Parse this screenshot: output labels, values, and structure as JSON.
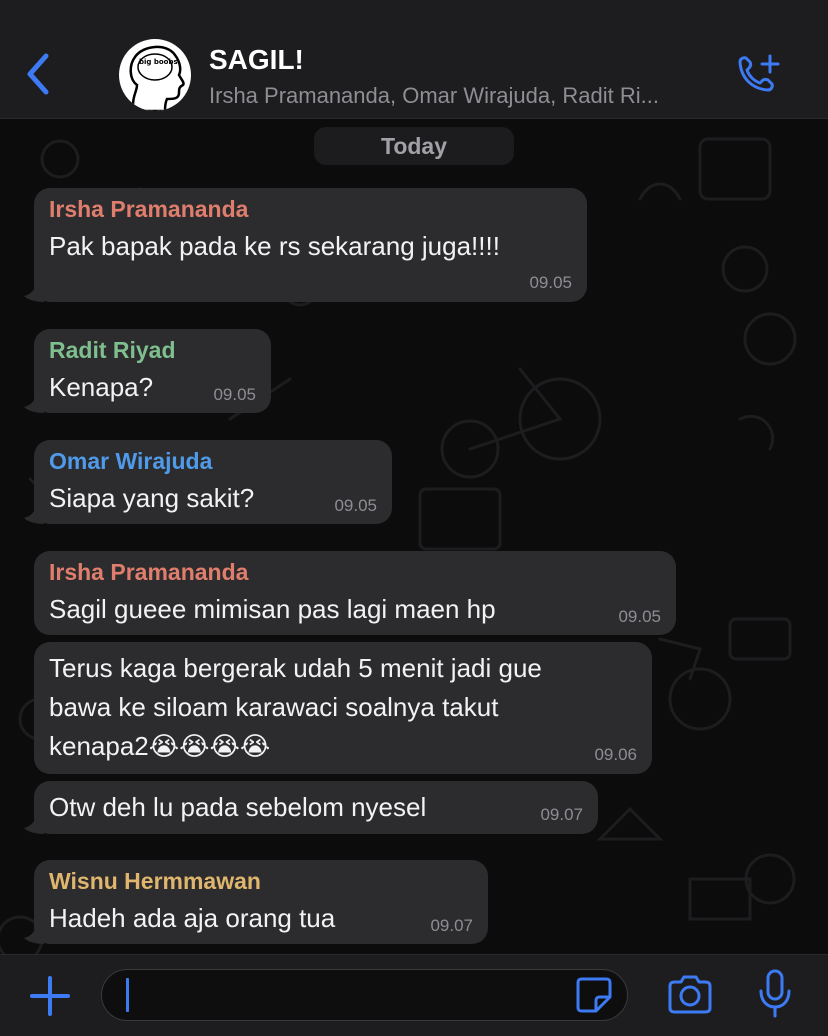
{
  "header": {
    "title": "SAGIL!",
    "subtitle": "Irsha Pramananda, Omar Wirajuda, Radit Ri...",
    "avatar_text": "big boobs"
  },
  "date_divider": "Today",
  "messages": [
    {
      "sender": "Irsha Pramananda",
      "sender_color": "#e07e6d",
      "lines": [
        "Pak bapak pada ke rs sekarang juga!!!!"
      ],
      "time": "09.05"
    },
    {
      "sender": "Radit Riyad",
      "sender_color": "#7fbf8e",
      "lines": [
        "Kenapa?"
      ],
      "time": "09.05"
    },
    {
      "sender": "Omar Wirajuda",
      "sender_color": "#4f9bea",
      "lines": [
        "Siapa yang sakit?"
      ],
      "time": "09.05"
    },
    {
      "sender": "Irsha Pramananda",
      "sender_color": "#e07e6d",
      "lines": [
        "Sagil gueee mimisan pas lagi maen hp"
      ],
      "time": "09.05"
    },
    {
      "sender": "",
      "lines": [
        "Terus kaga bergerak udah 5 menit jadi gue",
        "bawa ke siloam karawaci soalnya takut",
        "kenapa2😭😭😭😭"
      ],
      "time": "09.06"
    },
    {
      "sender": "",
      "lines": [
        "Otw deh lu pada sebelom nyesel"
      ],
      "time": "09.07"
    },
    {
      "sender": "Wisnu Hermmawan",
      "sender_color": "#e0b56d",
      "lines": [
        "Hadeh ada aja orang tua"
      ],
      "time": "09.07"
    }
  ],
  "composer": {
    "input_value": ""
  },
  "colors": {
    "accent": "#3d7bf5",
    "bubble": "#2c2c2e",
    "background": "#0c0c0c"
  },
  "icons": {
    "back": "chevron-left-icon",
    "call": "phone-plus-icon",
    "attach": "plus-icon",
    "sticker": "sticker-icon",
    "camera": "camera-icon",
    "mic": "microphone-icon"
  }
}
